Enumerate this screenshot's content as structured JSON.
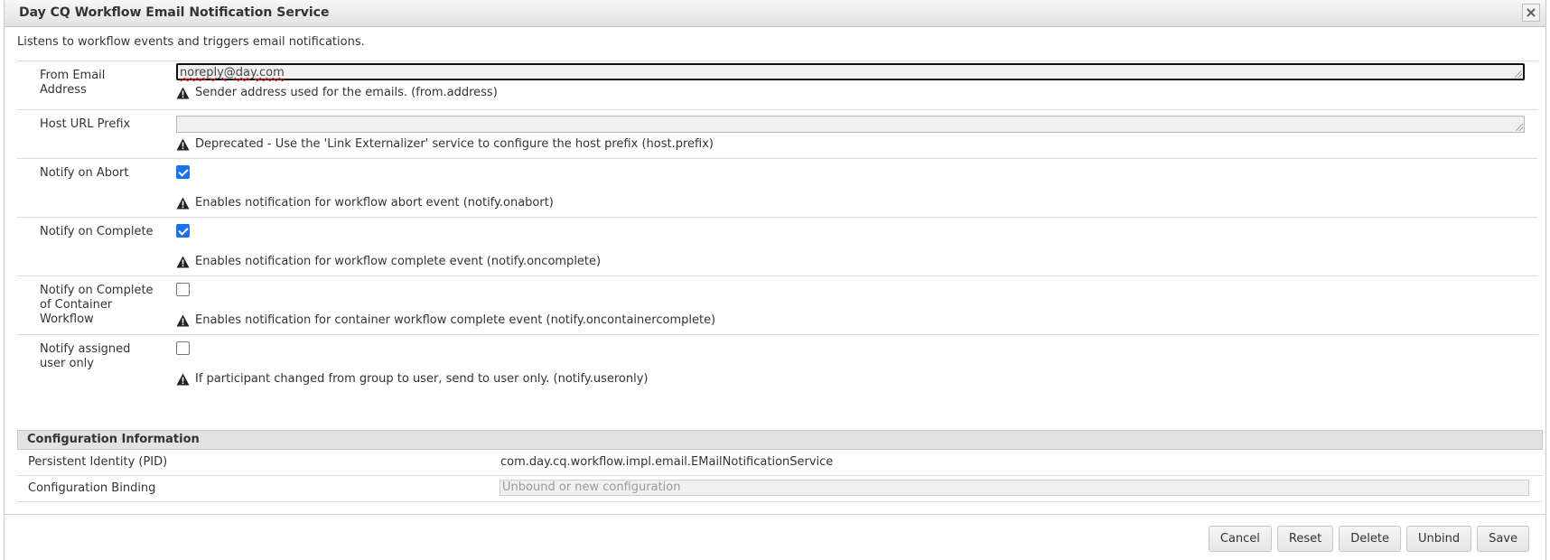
{
  "dialog": {
    "title": "Day CQ Workflow Email Notification Service",
    "close_label": "×",
    "description": "Listens to workflow events and triggers email notifications."
  },
  "fields": {
    "from_address": {
      "label": "From Email Address",
      "value": "noreply@day.com",
      "hint": "Sender address used for the emails. (from.address)"
    },
    "host_prefix": {
      "label": "Host URL Prefix",
      "value": "",
      "hint": "Deprecated - Use the 'Link Externalizer' service to configure the host prefix (host.prefix)"
    },
    "notify_onabort": {
      "label": "Notify on Abort",
      "checked": true,
      "hint": "Enables notification for workflow abort event (notify.onabort)"
    },
    "notify_oncomplete": {
      "label": "Notify on Complete",
      "checked": true,
      "hint": "Enables notification for workflow complete event (notify.oncomplete)"
    },
    "notify_oncontainercomplete": {
      "label": "Notify on Complete of Container Workflow",
      "checked": false,
      "hint": "Enables notification for container workflow complete event (notify.oncontainercomplete)"
    },
    "notify_useronly": {
      "label": "Notify assigned user only",
      "checked": false,
      "hint": "If participant changed from group to user, send to user only. (notify.useronly)"
    }
  },
  "config_info": {
    "header": "Configuration Information",
    "pid_label": "Persistent Identity (PID)",
    "pid_value": "com.day.cq.workflow.impl.email.EMailNotificationService",
    "binding_label": "Configuration Binding",
    "binding_value": "Unbound or new configuration"
  },
  "buttons": {
    "cancel": "Cancel",
    "reset": "Reset",
    "delete": "Delete",
    "unbind": "Unbind",
    "save": "Save"
  },
  "icons": {
    "close": "close-icon",
    "warning": "warning-icon",
    "resize_grip": "resize-grip-icon"
  },
  "colors": {
    "checkbox_accent": "#1a73e8",
    "header_bg": "#e3e3e3"
  }
}
